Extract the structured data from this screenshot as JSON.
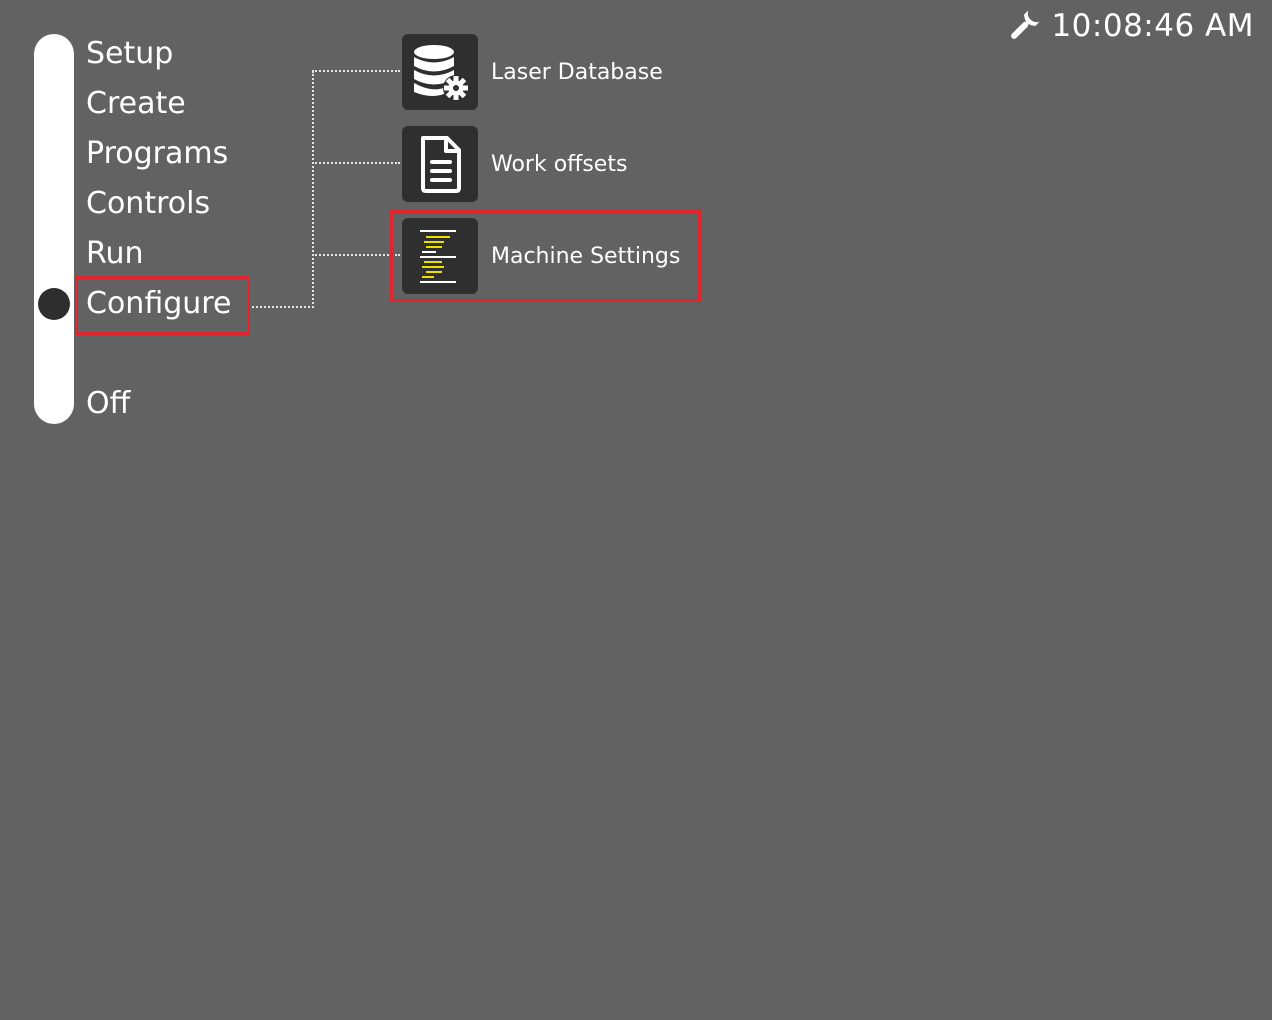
{
  "clock": {
    "icon": "wrench-icon",
    "time": "10:08:46 AM"
  },
  "mode_menu": {
    "selected": "Configure",
    "items": [
      {
        "label": "Setup"
      },
      {
        "label": "Create"
      },
      {
        "label": "Programs"
      },
      {
        "label": "Controls"
      },
      {
        "label": "Run"
      },
      {
        "label": "Configure"
      },
      {
        "label": "Off"
      }
    ]
  },
  "submenu": {
    "items": [
      {
        "label": "Laser Database",
        "icon": "database-gear-icon"
      },
      {
        "label": "Work offsets",
        "icon": "document-icon"
      },
      {
        "label": "Machine Settings",
        "icon": "settings-list-icon"
      }
    ]
  },
  "colors": {
    "background": "#626262",
    "highlight": "#e0252f",
    "icon_tile": "#2f2f2f",
    "accent_yellow": "#e8e100"
  }
}
